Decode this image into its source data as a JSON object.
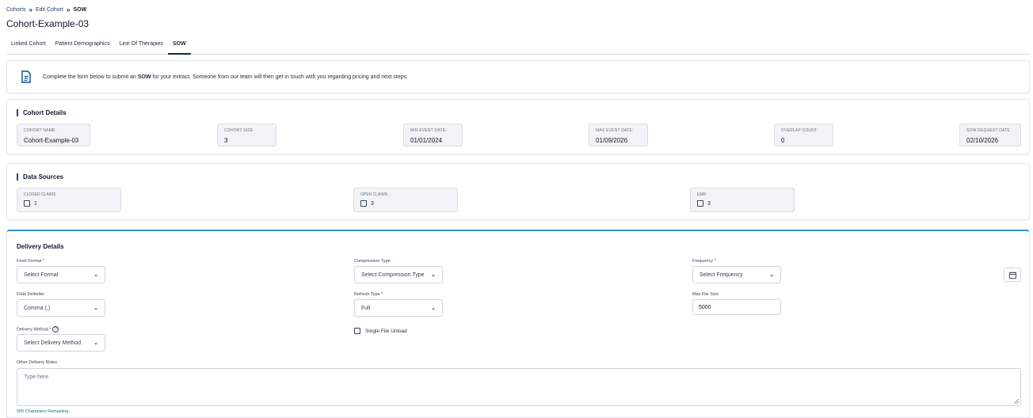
{
  "breadcrumb": {
    "item1": "Cohorts",
    "item2": "Edit Cohort",
    "current": "SOW",
    "separator": "»"
  },
  "page_title": "Cohort-Example-03",
  "tabs": [
    "Linked Cohort",
    "Patient Demographics",
    "Line Of Therapies",
    "SOW"
  ],
  "active_tab": "SOW",
  "info": {
    "prefix": "Complete the form below to submit an ",
    "highlight": "SOW",
    "suffix": " for your extract. Someone from our team will then get in touch with you regarding pricing and next steps."
  },
  "cohort_details": {
    "title": "Cohort Details",
    "fields": [
      {
        "label": "Cohort Name:",
        "value": "Cohort-Example-03"
      },
      {
        "label": "Cohort Size:",
        "value": "3"
      },
      {
        "label": "Min Event Date:",
        "value": "01/01/2024"
      },
      {
        "label": "Max Event Date:",
        "value": "01/09/2026"
      },
      {
        "label": "Overlap Count",
        "value": "0"
      },
      {
        "label": "SOW Request Date",
        "value": "02/10/2026"
      }
    ]
  },
  "data_sources": {
    "title": "Data Sources",
    "items": [
      {
        "label": "Closed Claims",
        "count": "1"
      },
      {
        "label": "Open Claims",
        "count": "3"
      },
      {
        "label": "EMR",
        "count": "3"
      }
    ]
  },
  "delivery": {
    "title": "Delivery Details",
    "feed_format": {
      "label": "Feed Format",
      "required": "*",
      "value": "Select Format"
    },
    "compression_type": {
      "label": "Compression Type",
      "value": "Select Compression Type"
    },
    "frequency": {
      "label": "Frequency",
      "required": "*",
      "value": "Select Frequency"
    },
    "field_delimiter": {
      "label": "Field Delimiter",
      "value": "Comma (,)"
    },
    "refresh_type": {
      "label": "Refresh Type",
      "required": "*",
      "value": "Full"
    },
    "max_file_size": {
      "label": "Max File Size",
      "value": "5000"
    },
    "delivery_method": {
      "label": "Delivery Method",
      "required": "*",
      "value": "Select Delivery Method",
      "help": "?"
    },
    "single_file_unload": "Single File Unload",
    "notes": {
      "label": "Other Delivery Notes",
      "placeholder": "Type here",
      "remaining": "500 Characters Remaining"
    }
  },
  "icons": {
    "info": "document-icon",
    "calendar": "calendar-icon",
    "chevron": "chevron-down-icon"
  },
  "colors": {
    "accent": "#0f4c8a",
    "top_border": "#2f8fe0",
    "remaining_text": "#0f766e"
  }
}
